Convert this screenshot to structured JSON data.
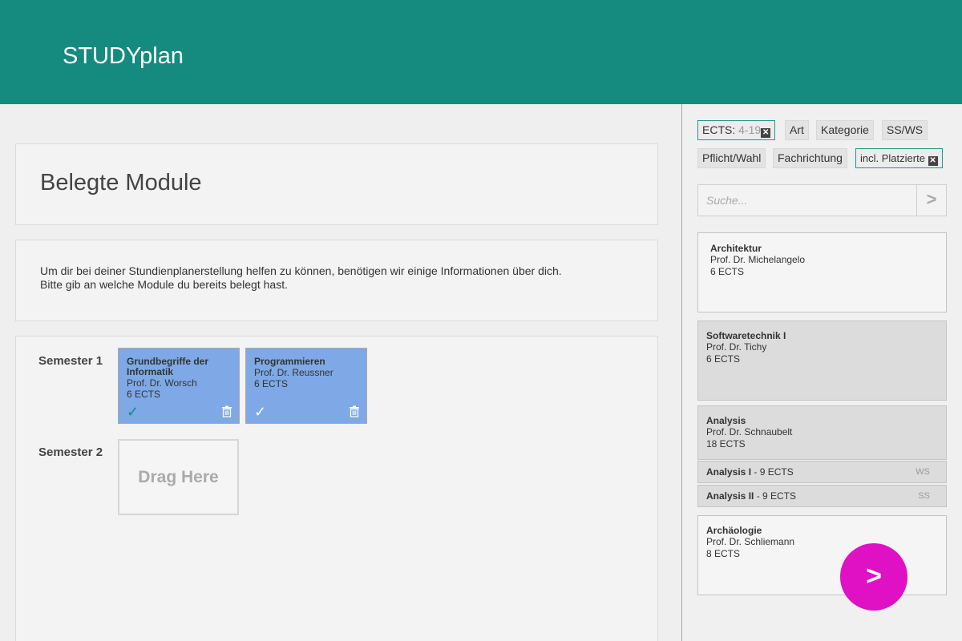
{
  "app": {
    "title": "STUDYplan"
  },
  "main": {
    "heading": "Belegte Module",
    "info_line1": "Um dir bei deiner Stundienplanerstellung helfen zu können, benötigen wir einige Informationen über dich.",
    "info_line2": "Bitte gib an welche Module du bereits belegt hast.",
    "semesters": [
      {
        "label": "Semester 1",
        "modules": [
          {
            "name": "Grundbegriffe der Informatik",
            "prof": "Prof. Dr. Worsch",
            "ects": "6 ECTS",
            "check": "✓"
          },
          {
            "name": "Programmieren",
            "prof": "Prof. Dr. Reussner",
            "ects": "6 ECTS",
            "check": "✓"
          }
        ]
      },
      {
        "label": "Semester 2",
        "drag_placeholder": "Drag Here"
      }
    ]
  },
  "sidebar": {
    "filters": [
      {
        "label": "ECTS:",
        "range": "4-19",
        "active": true
      },
      {
        "label": "Art"
      },
      {
        "label": "Kategorie"
      },
      {
        "label": "SS/WS"
      },
      {
        "label": "Pflicht/Wahl"
      },
      {
        "label": "Fachrichtung"
      },
      {
        "label": "incl. Platzierte",
        "active": true
      }
    ],
    "search": {
      "placeholder": "Suche...",
      "go": ">"
    },
    "modules": [
      {
        "name": "Architektur",
        "prof": "Prof. Dr. Michelangelo",
        "ects": "6 ECTS"
      },
      {
        "name": "Softwaretechnik I",
        "prof": "Prof. Dr. Tichy",
        "ects": "6 ECTS"
      },
      {
        "name": "Analysis",
        "prof": "Prof. Dr. Schnaubelt",
        "ects": "18 ECTS",
        "parts": [
          {
            "name": "Analysis I",
            "ects": " - 9 ECTS",
            "term": "WS"
          },
          {
            "name": "Analysis II",
            "ects": " - 9 ECTS",
            "term": "SS"
          }
        ]
      },
      {
        "name": "Archäologie",
        "prof": "Prof. Dr. Schliemann",
        "ects": "8 ECTS"
      }
    ]
  },
  "fab": {
    "label": ">"
  },
  "colors": {
    "header": "#158a7e",
    "module_card": "#7ea9e6",
    "fab": "#e010c4",
    "check": "#158a7e"
  },
  "icons": {
    "remove": "close-icon",
    "delete": "trash-icon",
    "done": "check-icon",
    "next": "chevron-right-icon"
  }
}
